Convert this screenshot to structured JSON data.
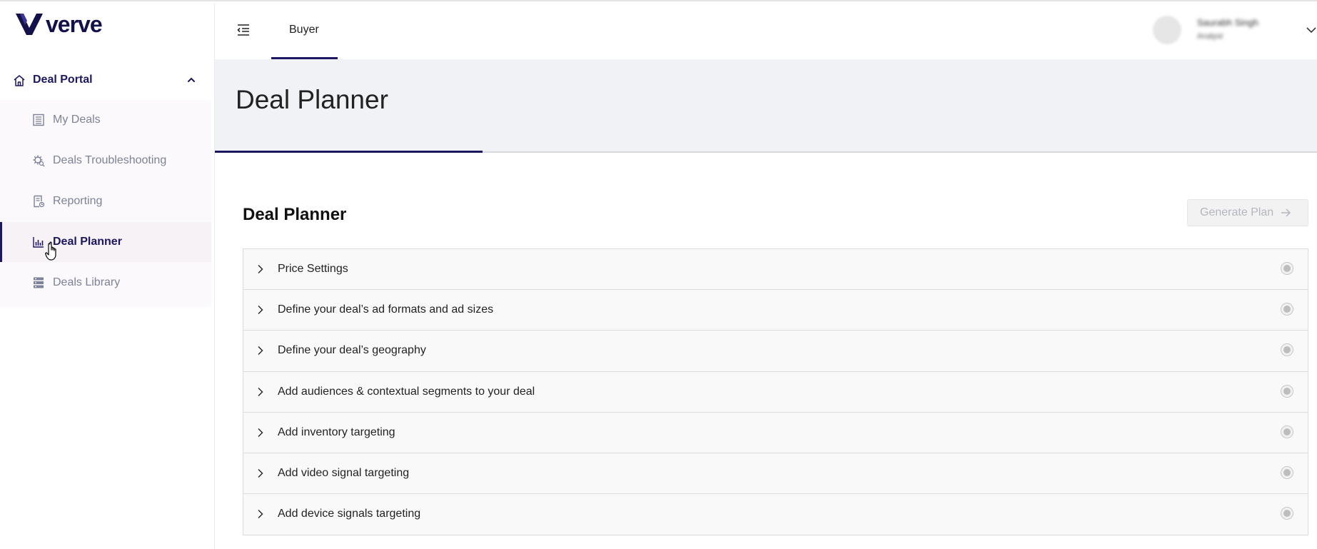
{
  "brand": {
    "name": "verve",
    "color": "#1d1660"
  },
  "sidebar": {
    "section_label": "Deal Portal",
    "items": [
      {
        "label": "My Deals",
        "icon": "building-icon",
        "active": false
      },
      {
        "label": "Deals Troubleshooting",
        "icon": "gear-search-icon",
        "active": false
      },
      {
        "label": "Reporting",
        "icon": "report-icon",
        "active": false
      },
      {
        "label": "Deal Planner",
        "icon": "bar-chart-icon",
        "active": true
      },
      {
        "label": "Deals Library",
        "icon": "library-icon",
        "active": false
      }
    ]
  },
  "topbar": {
    "tab_label": "Buyer",
    "user_name": "Saurabh Singh",
    "user_role": "Analyst"
  },
  "header": {
    "title": "Deal Planner"
  },
  "content": {
    "title": "Deal Planner",
    "generate_label": "Generate Plan",
    "accordion": [
      {
        "label": "Price Settings"
      },
      {
        "label": "Define your deal’s ad formats and ad sizes"
      },
      {
        "label": "Define your deal’s geography"
      },
      {
        "label": "Add audiences & contextual segments to your deal"
      },
      {
        "label": "Add inventory targeting"
      },
      {
        "label": "Add video signal targeting"
      },
      {
        "label": "Add device signals targeting"
      }
    ]
  }
}
